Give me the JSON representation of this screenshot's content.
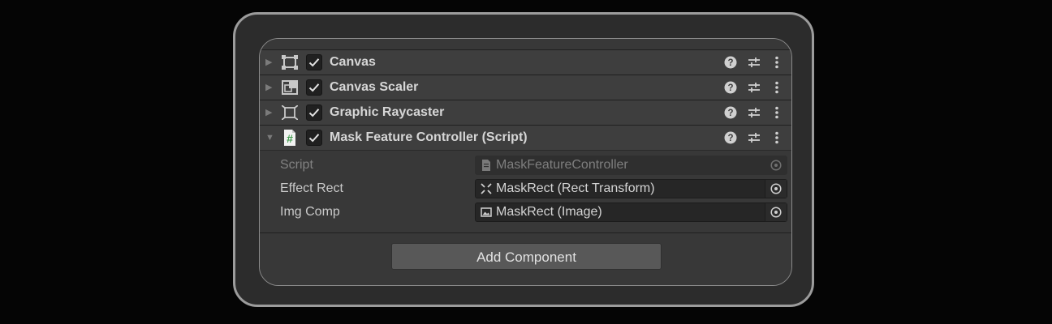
{
  "components": [
    {
      "title": "Canvas",
      "icon": "canvas-icon",
      "enabled": true,
      "expanded": false
    },
    {
      "title": "Canvas Scaler",
      "icon": "canvas-scaler-icon",
      "enabled": true,
      "expanded": false
    },
    {
      "title": "Graphic Raycaster",
      "icon": "graphic-raycaster-icon",
      "enabled": true,
      "expanded": false
    },
    {
      "title": "Mask Feature Controller (Script)",
      "icon": "csharp-script-icon",
      "enabled": true,
      "expanded": true
    }
  ],
  "script_component": {
    "properties": [
      {
        "label": "Script",
        "value": "MaskFeatureController",
        "icon": "script-asset-icon",
        "disabled": true
      },
      {
        "label": "Effect Rect",
        "value": "MaskRect (Rect Transform)",
        "icon": "rect-transform-icon",
        "disabled": false
      },
      {
        "label": "Img Comp",
        "value": "MaskRect (Image)",
        "icon": "image-icon",
        "disabled": false
      }
    ]
  },
  "add_component_label": "Add Component",
  "colors": {
    "script_icon_green": "#3f9b4c",
    "text": "#d6d6d6",
    "panel": "#383838",
    "header": "#3e3e3e"
  }
}
